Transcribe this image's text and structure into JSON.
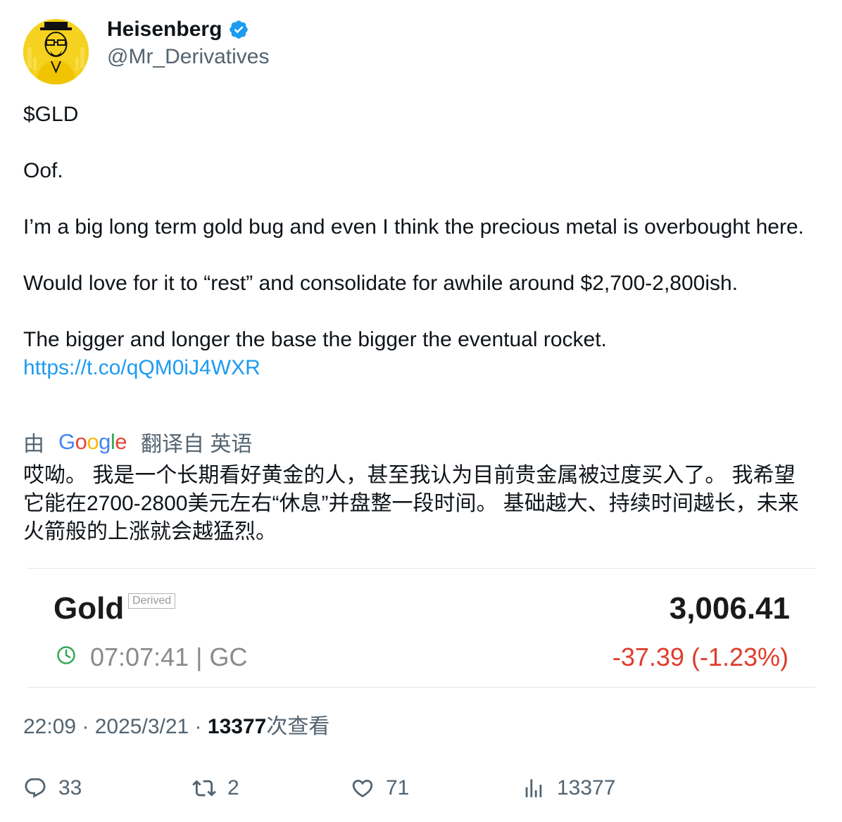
{
  "author": {
    "display_name": "Heisenberg",
    "handle": "@Mr_Derivatives",
    "avatar_icon": "heisenberg-portrait-icon",
    "verified_icon": "verified-badge-icon"
  },
  "tweet": {
    "line1": "$GLD",
    "line2": "Oof.",
    "line3": "I’m a big long term gold bug and even I think the precious metal is overbought here.",
    "line4": "Would love for it to “rest” and consolidate for awhile around $2,700-2,800ish.",
    "line5": "The bigger and longer the base the bigger the eventual rocket.",
    "link": "https://t.co/qQM0iJ4WXR"
  },
  "translation": {
    "by_label": "由",
    "logo_letters": [
      "G",
      "o",
      "o",
      "g",
      "l",
      "e"
    ],
    "from_label": "翻译自 英语",
    "text": "哎呦。 我是一个长期看好黄金的人，甚至我认为目前贵金属被过度买入了。 我希望它能在2700-2800美元左右“休息”并盘整一段时间。 基础越大、持续时间越长，未来火箭般的上涨就会越猛烈。"
  },
  "quote_card": {
    "name": "Gold",
    "badge": "Derived",
    "price": "3,006.41",
    "time": "07:07:41",
    "separator": "| GC",
    "change": "-37.39 (-1.23%)",
    "colors": {
      "change": "#e03c2b",
      "clock": "#34a853"
    }
  },
  "meta": {
    "time": "22:09",
    "dot1": " · ",
    "date": "2025/3/21",
    "dot2": " · ",
    "views": "13377",
    "views_label": "次查看"
  },
  "actions": {
    "replies": "33",
    "retweets": "2",
    "likes": "71",
    "views": "13377"
  },
  "colors": {
    "link": "#1d9bf0",
    "secondary_text": "#536471",
    "primary_text": "#0f1419"
  }
}
